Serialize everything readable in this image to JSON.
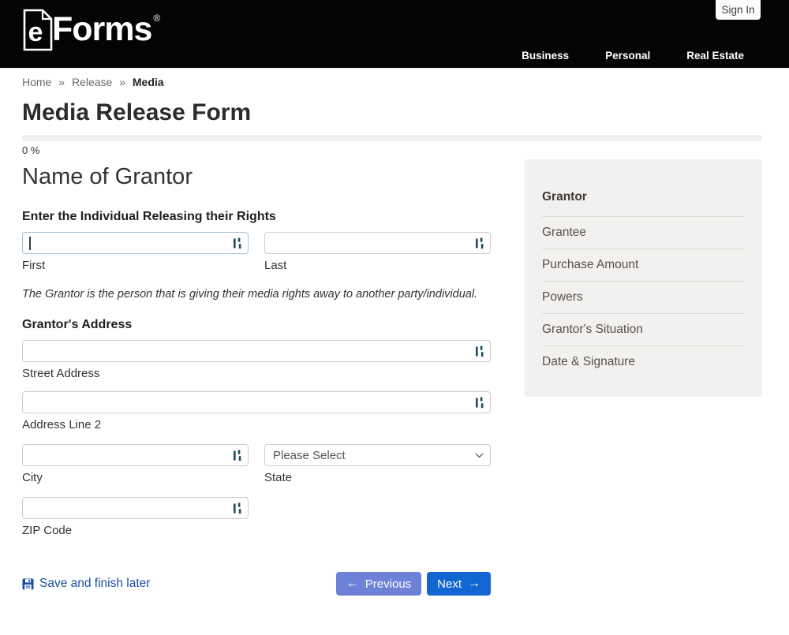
{
  "header": {
    "logo_letter": "e",
    "logo_text": "Forms",
    "registered": "®",
    "sign_in": "Sign In",
    "nav": [
      {
        "label": "Business"
      },
      {
        "label": "Personal"
      },
      {
        "label": "Real Estate"
      }
    ]
  },
  "breadcrumb": {
    "separator": "»",
    "items": [
      "Home",
      "Release",
      "Media"
    ]
  },
  "page": {
    "title": "Media Release Form",
    "progress_percent": "0 %"
  },
  "form": {
    "section_title": "Name of Grantor",
    "name_label": "Enter the Individual Releasing their Rights",
    "first": {
      "value": "",
      "label": "First"
    },
    "last": {
      "value": "",
      "label": "Last"
    },
    "note": "The Grantor is the person that is giving their media rights away to another party/individual.",
    "address_label": "Grantor's Address",
    "street": {
      "value": "",
      "label": "Street Address"
    },
    "line2": {
      "value": "",
      "label": "Address Line 2"
    },
    "city": {
      "value": "",
      "label": "City"
    },
    "state": {
      "selected": "Please Select",
      "label": "State"
    },
    "zip": {
      "value": "",
      "label": "ZIP Code"
    }
  },
  "footer_actions": {
    "save_link": "Save and finish later",
    "previous": "Previous",
    "next": "Next"
  },
  "sidebar": {
    "items": [
      {
        "label": "Grantor",
        "active": true
      },
      {
        "label": "Grantee",
        "active": false
      },
      {
        "label": "Purchase Amount",
        "active": false
      },
      {
        "label": "Powers",
        "active": false
      },
      {
        "label": "Grantor's Situation",
        "active": false
      },
      {
        "label": "Date & Signature",
        "active": false
      }
    ]
  },
  "icons": {
    "arrow_left": "←",
    "arrow_right": "→"
  },
  "colors": {
    "header_bg": "#040404",
    "next_button": "#1266d2",
    "previous_button": "#6e81d9",
    "save_link": "#1d4fa5",
    "field_icon": "#1d4a5c",
    "sidebar_bg": "#f2f1ef",
    "focused_border": "#a3c4d8"
  }
}
